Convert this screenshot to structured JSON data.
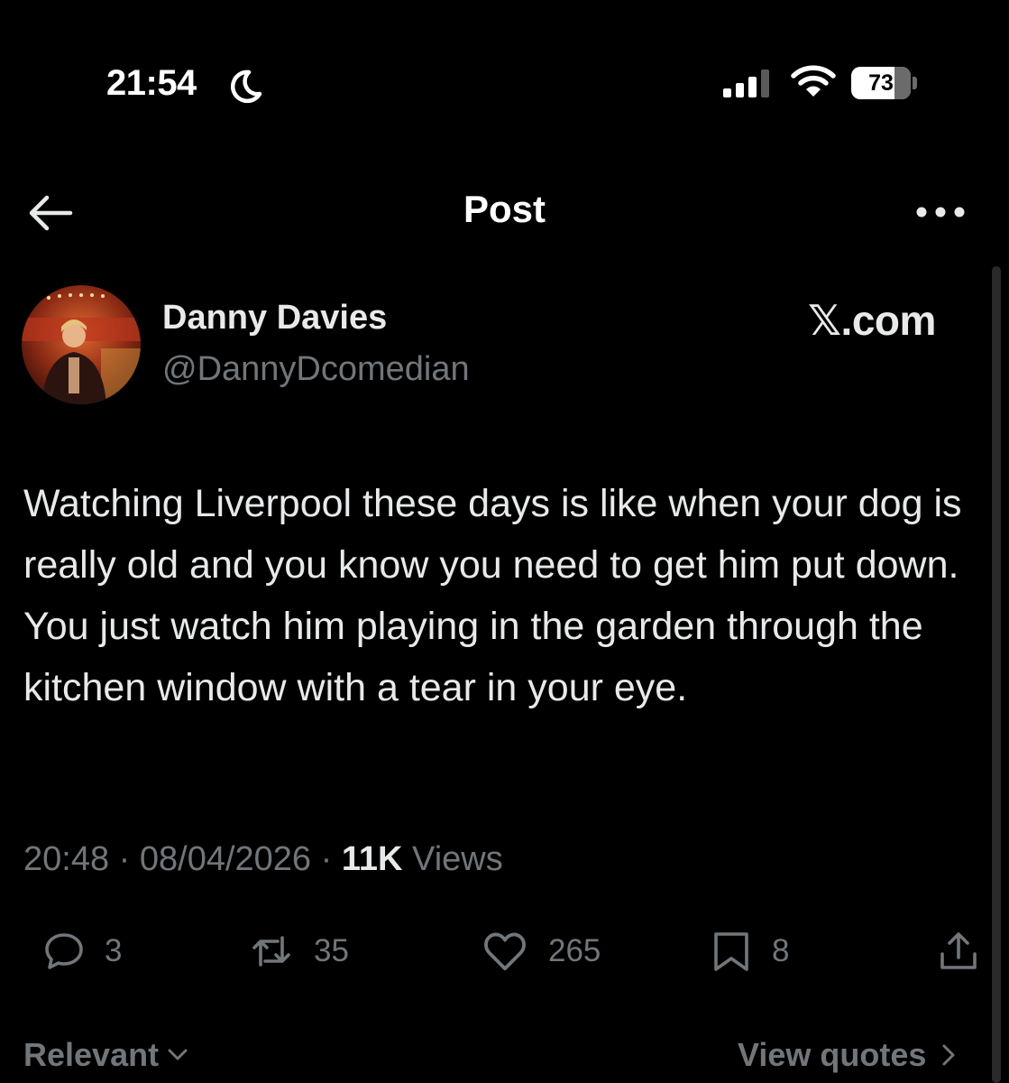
{
  "status_bar": {
    "time": "21:54",
    "battery": "73",
    "battery_level": 0.73
  },
  "header": {
    "title": "Post"
  },
  "author": {
    "name": "Danny Davies",
    "handle": "@DannyDcomedian"
  },
  "brand_mark": "𝕏.com",
  "tweet": {
    "text": "Watching Liverpool these days is like when your dog is really old and you know you need to get him put down. You just watch him playing in the garden through the kitchen window with a tear in your eye."
  },
  "meta": {
    "time": "20:48",
    "separator": "·",
    "date": "08/04/2026",
    "views_count": "11K",
    "views_label": "Views"
  },
  "actions": {
    "replies": "3",
    "reposts": "35",
    "likes": "265",
    "bookmarks": "8"
  },
  "footer": {
    "sort_label": "Relevant",
    "view_quotes_label": "View quotes"
  },
  "icons": {
    "status": [
      "moon-icon",
      "signal-icon",
      "wifi-icon"
    ],
    "header": [
      "back-arrow-icon",
      "more-icon"
    ],
    "actions": [
      "reply-icon",
      "repost-icon",
      "like-icon",
      "bookmark-icon",
      "share-icon"
    ]
  },
  "colors": {
    "background": "#000000",
    "text_primary": "#e7e9ea",
    "text_secondary": "#71767b"
  }
}
